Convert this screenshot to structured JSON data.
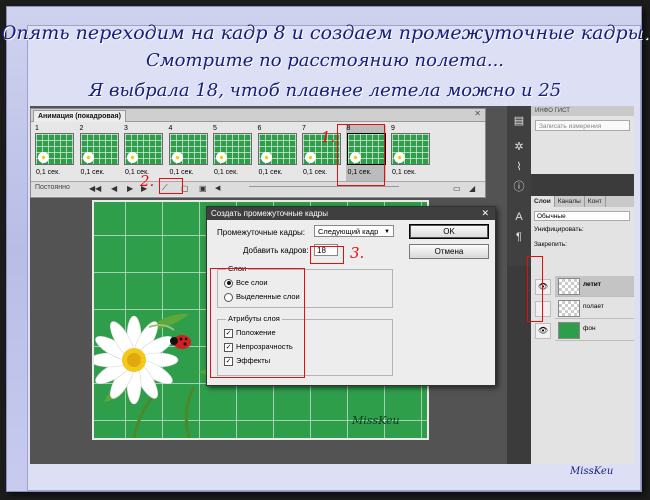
{
  "headline": {
    "line1": "Опять переходим на кадр 8 и создаем промежуточные кадры.",
    "line2": "Смотрите по расстоянию полета...",
    "line3": "Я выбрала 18, чтоб плавнее летела можно и 25"
  },
  "animation_panel": {
    "tab_label": "Анимация (покадровая)",
    "close_glyph": "✕",
    "frames": [
      {
        "num": "1",
        "time": "0,1 сек."
      },
      {
        "num": "2",
        "time": "0,1 сек."
      },
      {
        "num": "3",
        "time": "0,1 сек."
      },
      {
        "num": "4",
        "time": "0,1 сек."
      },
      {
        "num": "5",
        "time": "0,1 сек."
      },
      {
        "num": "6",
        "time": "0,1 сек."
      },
      {
        "num": "7",
        "time": "0,1 сек."
      },
      {
        "num": "8",
        "time": "0,1 сек."
      },
      {
        "num": "9",
        "time": "0,1 сек."
      }
    ],
    "loop_label": "Постоянно",
    "selected_frame": "8"
  },
  "info_panel": {
    "tabs": "ИНФО   ГИСТ",
    "record_button": "Записать измерения"
  },
  "layers_panel": {
    "tabs": [
      "Слои",
      "Каналы",
      "Конт"
    ],
    "blend_mode": "Обычные",
    "unify_label": "Унифицировать:",
    "lock_label": "Закрепить:",
    "layers": [
      {
        "name": "летит",
        "visible": true,
        "active": true,
        "thumb": "checker"
      },
      {
        "name": "полает",
        "visible": false,
        "active": false,
        "thumb": "checker"
      },
      {
        "name": "фон",
        "visible": true,
        "active": false,
        "thumb": "green"
      }
    ]
  },
  "canvas": {
    "signature": "MissKeu"
  },
  "dialog": {
    "title": "Создать промежуточные кадры",
    "close_glyph": "✕",
    "tween_label": "Промежуточные кадры:",
    "tween_value": "Следующий кадр",
    "add_label": "Добавить кадров:",
    "add_value": "18",
    "ok_label": "OK",
    "cancel_label": "Отмена",
    "layers_group": "Слои",
    "layers_options": [
      "Все слои",
      "Выделенные слои"
    ],
    "attr_group": "Атрибуты слоя",
    "attr_options": [
      "Положение",
      "Непрозрачность",
      "Эффекты"
    ]
  },
  "annotations": {
    "n1": "1.",
    "n2": "2.",
    "n3": "3."
  },
  "watermark": "MissKeu",
  "colors": {
    "annotation_red": "#e01010",
    "headline_blue": "#161e78",
    "canvas_green": "#2f9e4b"
  }
}
